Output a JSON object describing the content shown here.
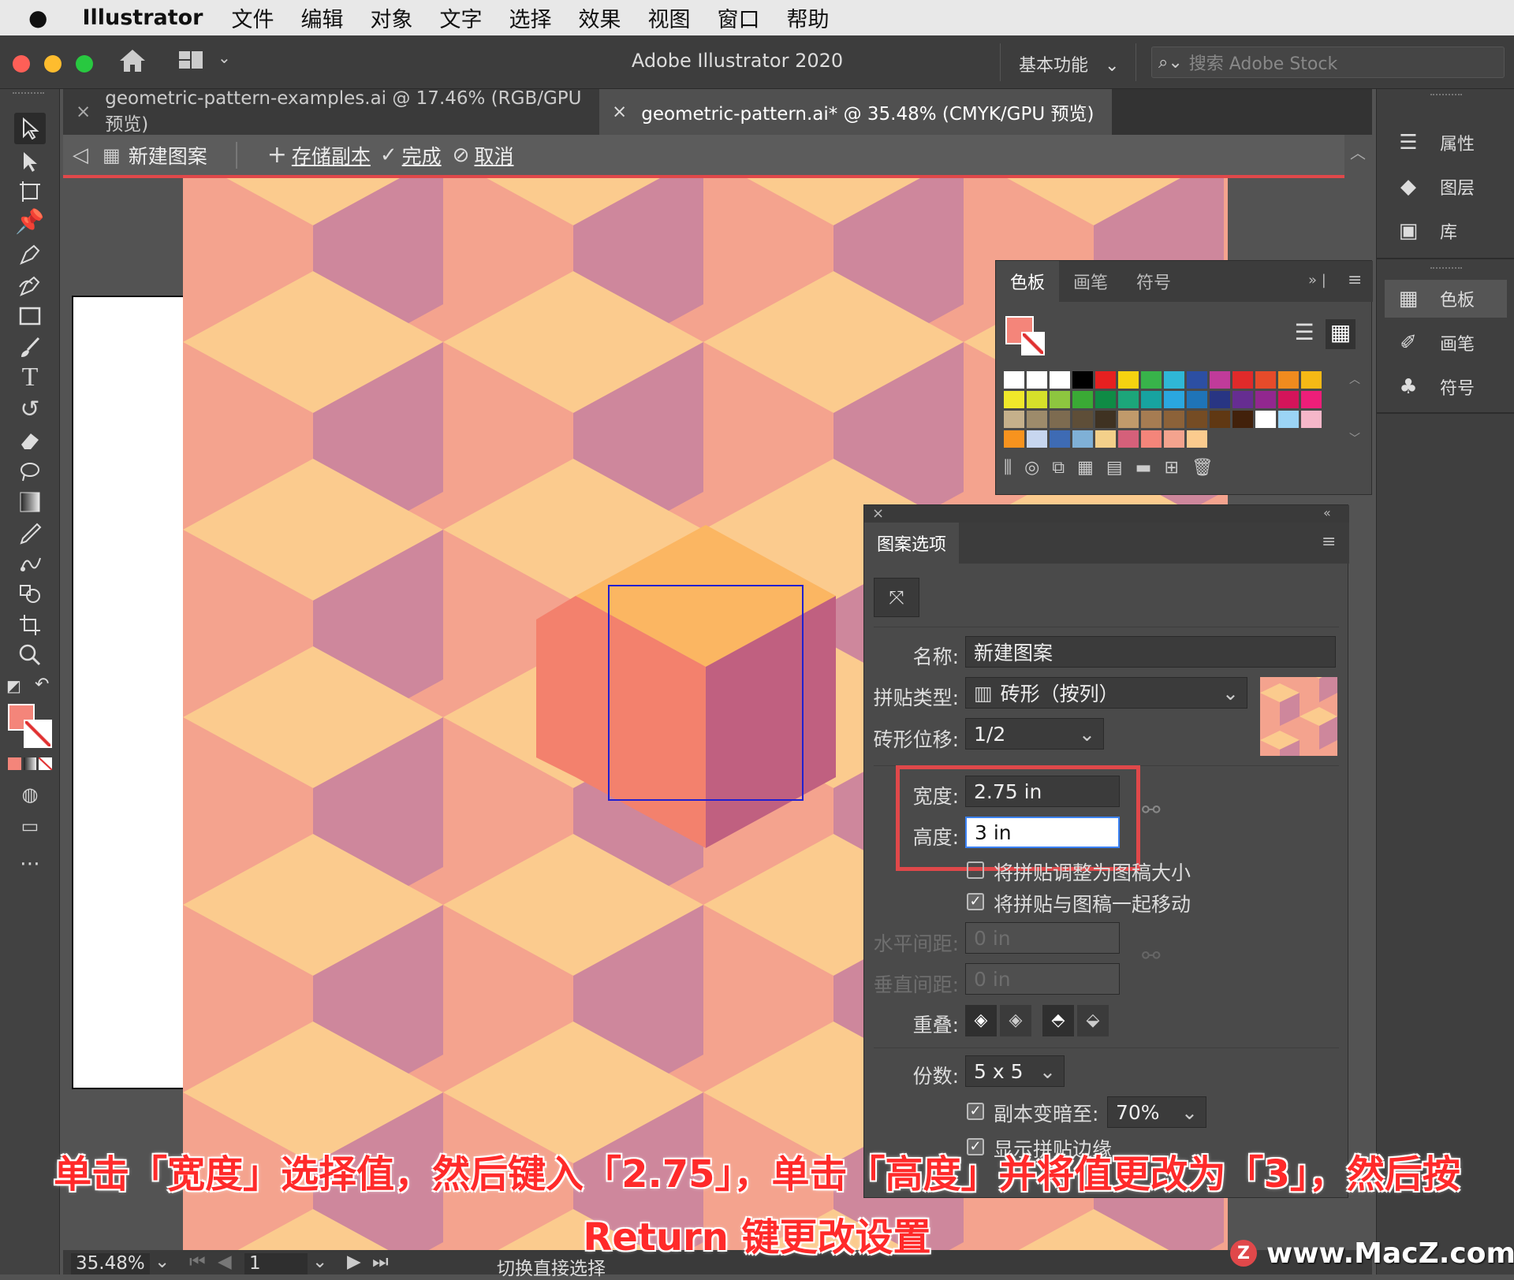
{
  "menubar": {
    "app_name": "Illustrator",
    "items": [
      "文件",
      "编辑",
      "对象",
      "文字",
      "选择",
      "效果",
      "视图",
      "窗口",
      "帮助"
    ]
  },
  "titlebar": {
    "title": "Adobe Illustrator 2020",
    "workspace": "基本功能",
    "search_placeholder": "搜索 Adobe Stock"
  },
  "tabs": [
    {
      "label": "geometric-pattern-examples.ai @ 17.46% (RGB/GPU 预览)"
    },
    {
      "label": "geometric-pattern.ai* @ 35.48% (CMYK/GPU 预览)"
    }
  ],
  "pattern_bar": {
    "name": "新建图案",
    "save_copy": "存储副本",
    "done": "完成",
    "cancel": "取消"
  },
  "right_dock": {
    "group1": [
      "属性",
      "图层",
      "库"
    ],
    "group2": [
      "色板",
      "画笔",
      "符号"
    ]
  },
  "swatches_panel": {
    "tabs": [
      "色板",
      "画笔",
      "符号"
    ],
    "fill_color": "#F4857A"
  },
  "pattern_options": {
    "title": "图案选项",
    "name_label": "名称:",
    "name_value": "新建图案",
    "tile_type_label": "拼贴类型:",
    "tile_type_value": "砖形（按列）",
    "brick_offset_label": "砖形位移:",
    "brick_offset_value": "1/2",
    "width_label": "宽度:",
    "width_value": "2.75 in",
    "height_label": "高度:",
    "height_value": "3 in",
    "fit_tile_label": "将拼贴调整为图稿大小",
    "move_tile_label": "将拼贴与图稿一起移动",
    "h_spacing_label": "水平间距:",
    "h_spacing_value": "0 in",
    "v_spacing_label": "垂直间距:",
    "v_spacing_value": "0 in",
    "overlap_label": "重叠:",
    "copies_label": "份数:",
    "copies_value": "5 x 5",
    "dim_copies_label": "副本变暗至:",
    "dim_copies_value": "70%",
    "show_tile_edge_label": "显示拼贴边缘"
  },
  "statusbar": {
    "zoom": "35.48%",
    "artboard": "1",
    "tool_hint": "切换直接选择"
  },
  "caption": {
    "line1": "单击「宽度」选择值，然后键入「2.75」，单击「高度」并将值更改为「3」，然后按",
    "line2": "Return 键更改设置"
  },
  "watermark": "www.MacZ.com",
  "colors": {
    "accent_red": "#E0484A",
    "cube_light": "#FBCB8E",
    "cube_pink": "#F4A38E",
    "cube_mauve": "#CE879C"
  }
}
